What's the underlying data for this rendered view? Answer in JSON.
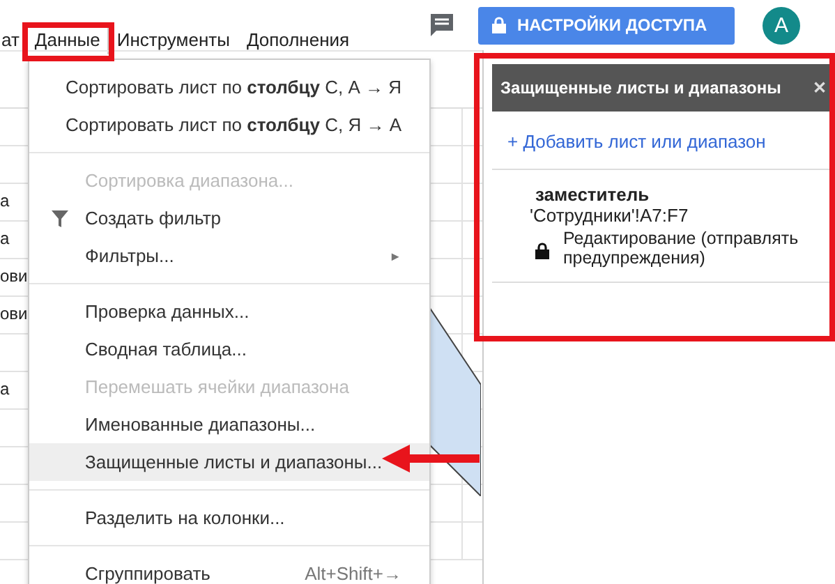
{
  "menubar": {
    "items": [
      {
        "label": "ат",
        "selected": false
      },
      {
        "label": "Данные",
        "selected": true
      },
      {
        "label": "Инструменты",
        "selected": false
      },
      {
        "label": "Дополнения",
        "selected": false
      }
    ]
  },
  "sheet": {
    "cells": [
      "а",
      "а",
      "ови",
      "ови",
      "а"
    ]
  },
  "header": {
    "share_button": "НАСТРОЙКИ ДОСТУПА",
    "avatar": "A"
  },
  "menu": {
    "sections": [
      [
        {
          "label": "Сортировать лист по **столбцу** С, А → Я",
          "disabled": false,
          "selected": false
        },
        {
          "label": "Сортировать лист по **столбцу** С, Я → А",
          "disabled": false,
          "selected": false
        }
      ],
      [
        {
          "label": "Сортировка диапазона...",
          "disabled": true,
          "selected": false
        },
        {
          "label": "Создать фильтр",
          "disabled": false,
          "selected": false,
          "kind": "filter"
        },
        {
          "label": "Фильтры...",
          "disabled": false,
          "selected": false,
          "kind": "submenu",
          "submenu_mark": "►"
        }
      ],
      [
        {
          "label": "Проверка данных...",
          "disabled": false,
          "selected": false
        },
        {
          "label": "Сводная таблица...",
          "disabled": false,
          "selected": false
        },
        {
          "label": "Перемешать ячейки диапазона",
          "disabled": true,
          "selected": false
        },
        {
          "label": "Именованные диапазоны...",
          "disabled": false,
          "selected": false
        },
        {
          "label": "Защищенные листы и диапазоны...",
          "disabled": false,
          "selected": true
        }
      ],
      [
        {
          "label": "Разделить на колонки...",
          "disabled": false,
          "selected": false
        }
      ],
      [
        {
          "label": "Сгруппировать",
          "disabled": false,
          "selected": false,
          "shortcut": "Alt+Shift+→"
        }
      ]
    ]
  },
  "panel": {
    "title": "Защищенные листы и диапазоны",
    "close": "✕",
    "add_link": "+ Добавить лист или диапазон",
    "ranges": [
      {
        "name": "заместитель",
        "range": "'Сотрудники'!A7:F7",
        "permission": "Редактирование (отправлять предупреждения)"
      }
    ]
  }
}
